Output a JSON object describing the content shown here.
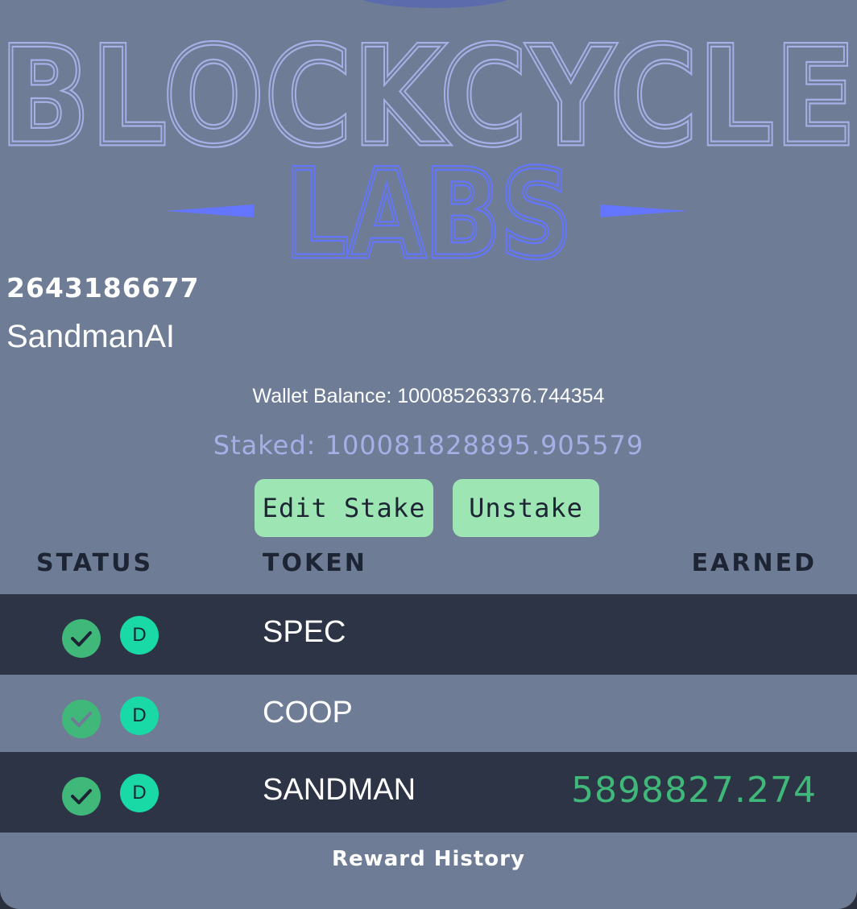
{
  "logo": {
    "line1": "BLOCKCYCLE",
    "line2": "LABS",
    "color_primary": "#a7afe6",
    "color_accent": "#6475ff"
  },
  "account": {
    "id": "2643186677",
    "name": "SandmanAI"
  },
  "wallet_balance": "Wallet Balance: 100085263376.744354",
  "staked": "Staked: 100081828895.905579",
  "buttons": {
    "edit_stake": "Edit Stake",
    "unstake": "Unstake"
  },
  "table": {
    "headers": {
      "status": "STATUS",
      "token": "TOKEN",
      "earned": "EARNED"
    },
    "rows": [
      {
        "badge": "D",
        "token": "SPEC",
        "earned": ""
      },
      {
        "badge": "D",
        "token": "COOP",
        "earned": ""
      },
      {
        "badge": "D",
        "token": "SANDMAN",
        "earned": "5898827.274"
      }
    ]
  },
  "reward_history": "Reward History",
  "colors": {
    "card_bg": "#6e7d95",
    "row_dark": "#2d3446",
    "button_bg": "#9de6b4",
    "check_green": "#3fb87a",
    "badge_teal": "#19d9a6",
    "staked_text": "#a7afe6"
  },
  "icons": {
    "status": "check-circle-icon",
    "badge": "d-badge-icon"
  }
}
